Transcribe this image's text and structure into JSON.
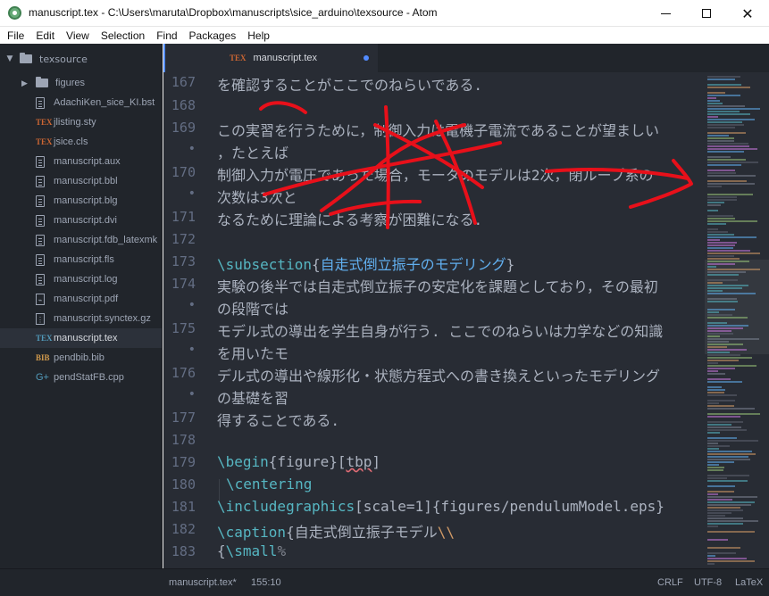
{
  "window": {
    "title": "manuscript.tex - C:\\Users\\maruta\\Dropbox\\manuscripts\\sice_arduino\\texsource - Atom"
  },
  "menu": [
    "File",
    "Edit",
    "View",
    "Selection",
    "Find",
    "Packages",
    "Help"
  ],
  "tree": {
    "root_label": "texsource",
    "items": [
      {
        "label": "figures",
        "type": "folder",
        "icon": "folder-icon"
      },
      {
        "label": "AdachiKen_sice_KI.bst",
        "type": "file",
        "icon": "file-text-icon"
      },
      {
        "label": "jlisting.sty",
        "type": "file",
        "icon": "tex-icon"
      },
      {
        "label": "jsice.cls",
        "type": "file",
        "icon": "tex-icon"
      },
      {
        "label": "manuscript.aux",
        "type": "file",
        "icon": "file-text-icon"
      },
      {
        "label": "manuscript.bbl",
        "type": "file",
        "icon": "file-text-icon"
      },
      {
        "label": "manuscript.blg",
        "type": "file",
        "icon": "file-text-icon"
      },
      {
        "label": "manuscript.dvi",
        "type": "file",
        "icon": "file-text-icon"
      },
      {
        "label": "manuscript.fdb_latexmk",
        "type": "file",
        "icon": "file-text-icon"
      },
      {
        "label": "manuscript.fls",
        "type": "file",
        "icon": "file-text-icon"
      },
      {
        "label": "manuscript.log",
        "type": "file",
        "icon": "file-text-icon"
      },
      {
        "label": "manuscript.pdf",
        "type": "file",
        "icon": "pdf-icon"
      },
      {
        "label": "manuscript.synctex.gz",
        "type": "file",
        "icon": "zip-icon"
      },
      {
        "label": "manuscript.tex",
        "type": "file",
        "icon": "tex-icon",
        "selected": true
      },
      {
        "label": "pendbib.bib",
        "type": "file",
        "icon": "bib-icon"
      },
      {
        "label": "pendStatFB.cpp",
        "type": "file",
        "icon": "cpp-icon"
      }
    ]
  },
  "tab": {
    "icon_text": "TEX",
    "label": "manuscript.tex",
    "modified": true
  },
  "gutter": [
    "167",
    "168",
    "169",
    "•",
    "170",
    "•",
    "171",
    "172",
    "173",
    "174",
    "•",
    "175",
    "•",
    "176",
    "•",
    "177",
    "178",
    "179",
    "180",
    "181",
    "182",
    "183"
  ],
  "code_lines": {
    "l0": "を確認することがここでのねらいである.",
    "l1": "",
    "l2": "この実習を行うために，制御入力は電機子電流であることが望ましい",
    "l3": "，たとえば",
    "l4": "制御入力が電圧であった場合，モータのモデルは2次，閉ループ系の",
    "l5": "次数は3次と",
    "l6": "なるために理論による考察が困難になる.",
    "l7": "",
    "l8a": "\\subsection",
    "l8b": "{",
    "l8c": "自走式倒立振子のモデリング",
    "l8d": "}",
    "l9": "実験の後半では自走式倒立振子の安定化を課題としており，その最初",
    "l10": "の段階では",
    "l11": "モデル式の導出を学生自身が行う. ここでのねらいは力学などの知識",
    "l12": "を用いたモ",
    "l13": "デル式の導出や線形化・状態方程式への書き換えといったモデリング",
    "l14": "の基礎を習",
    "l15": "得することである.",
    "l16": "",
    "l17a": "\\begin",
    "l17b": "{figure}[",
    "l17c": "tbp",
    "l17d": "]",
    "l18a": "\\centering",
    "l19a": "\\includegraphics",
    "l19b": "[scale=1]{figures/pendulumModel.eps}",
    "l20a": "\\caption",
    "l20b": "{自走式倒立振子モデル",
    "l20c": "\\\\",
    "l21a": "{",
    "l21b": "\\small",
    "l21c": "%"
  },
  "status": {
    "file": "manuscript.tex*",
    "cursor": "155:10",
    "line_ending": "CRLF",
    "encoding": "UTF-8",
    "grammar": "LaTeX"
  },
  "colors": {
    "background": "#282c34",
    "tree_background": "#21252b",
    "accent": "#528bff",
    "keyword": "#56b6c2",
    "bracket_text": "#61afef",
    "annotation": "#e8101a"
  }
}
